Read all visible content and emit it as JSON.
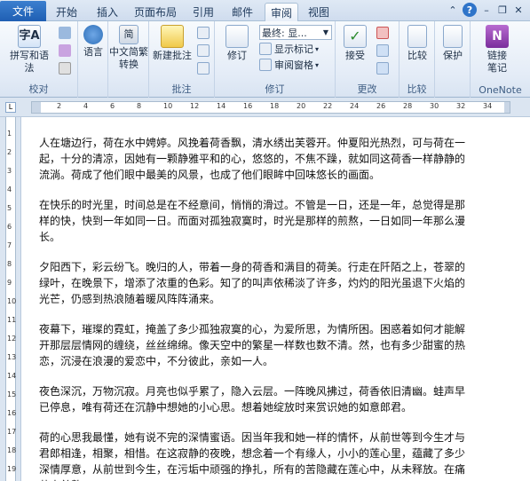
{
  "tabs": {
    "file": "文件",
    "items": [
      "开始",
      "插入",
      "页面布局",
      "引用",
      "邮件",
      "审阅",
      "视图"
    ],
    "active": "审阅"
  },
  "window_controls": {
    "help": "?"
  },
  "ribbon": {
    "groups": {
      "proofing": {
        "label": "校对",
        "spelling": "拼写和语法"
      },
      "language": {
        "label": "语言"
      },
      "chinese": {
        "label": "中文简繁转换",
        "line1": "中文简繁",
        "line2": "转换"
      },
      "comments": {
        "label": "批注",
        "new_comment": "新建批注"
      },
      "tracking": {
        "label": "修订",
        "track_changes": "修订",
        "display_for_review": "最终: 显...",
        "show_markup": "显示标记",
        "reviewing_pane": "审阅窗格"
      },
      "changes": {
        "label": "更改",
        "accept": "接受"
      },
      "compare": {
        "label": "比较",
        "compare": "比较"
      },
      "protect": {
        "protect": "保护"
      },
      "onenote": {
        "label": "OneNote",
        "line1": "链接",
        "line2": "笔记"
      }
    }
  },
  "ruler": {
    "numbers": [
      "2",
      "4",
      "6",
      "8",
      "10",
      "12",
      "14",
      "16",
      "18",
      "20",
      "22",
      "24",
      "26",
      "28",
      "30",
      "32",
      "34"
    ]
  },
  "vruler": {
    "numbers": [
      "1",
      "2",
      "3",
      "4",
      "5",
      "6",
      "7",
      "8",
      "9",
      "10",
      "11",
      "12",
      "13",
      "14",
      "15",
      "16",
      "17",
      "18",
      "19"
    ]
  },
  "document": {
    "paragraphs": [
      [
        "人在塘边行，荷在水中娉婷。风挽着荷香飘，清水绣出芙蓉开。仲夏阳光热烈，可与荷在一",
        "起，十分的清凉，因她有一颗静雅平和的心，悠悠的，不焦不躁，就如同这荷香一样静静的",
        "流淌。荷成了他们眼中最美的风景，也成了他们眼眸中回味悠长的画面。"
      ],
      [
        "在快乐的时光里，时间总是在不经意间，悄悄的滑过。不管是一日，还是一年，总觉得是那",
        "样的快，快到一年如同一日。而面对孤独寂寞时，时光是那样的煎熬，一日如同一年那么漫",
        "长。"
      ],
      [
        "夕阳西下，彩云纷飞。晚归的人，带着一身的荷香和满目的荷美。行走在阡陌之上，苍翠的",
        "绿叶，在晚景下，增添了浓重的色彩。知了的叫声依稀淡了许多，灼灼的阳光虽退下火焰的",
        "光芒，仍感到热浪随着暖风阵阵涌来。"
      ],
      [
        "夜幕下，璀璨的霓虹，掩盖了多少孤独寂寞的心，为爱所思，为情所困。困惑着如何才能解",
        "开那层层情网的缠绕，丝丝绵绵。像天空中的繁星一样数也数不清。然，也有多少甜蜜的热",
        "恋，沉浸在浪漫的爱恋中，不分彼此，亲如一人。"
      ],
      [
        "夜色深沉，万物沉寂。月亮也似乎累了，隐入云层。一阵晚风拂过，荷香依旧清幽。蛙声早",
        "已停息，唯有荷还在沉静中想她的小心思。想着她绽放时来赏识她的如意郎君。"
      ],
      [
        "荷的心思我最懂，她有说不完的深情蜜语。因当年我和她一样的情怀，从前世等到今生才与",
        "君郎相逢，相聚，相惜。在这寂静的夜晚，想念着一个有缘人，小小的莲心里，蕴藏了多少",
        "深情厚意，从前世到今生，在污垢中顽强的挣扎，所有的苦隐藏在莲心中，从未释放。在痛",
        "苦中煎熬。"
      ]
    ]
  }
}
